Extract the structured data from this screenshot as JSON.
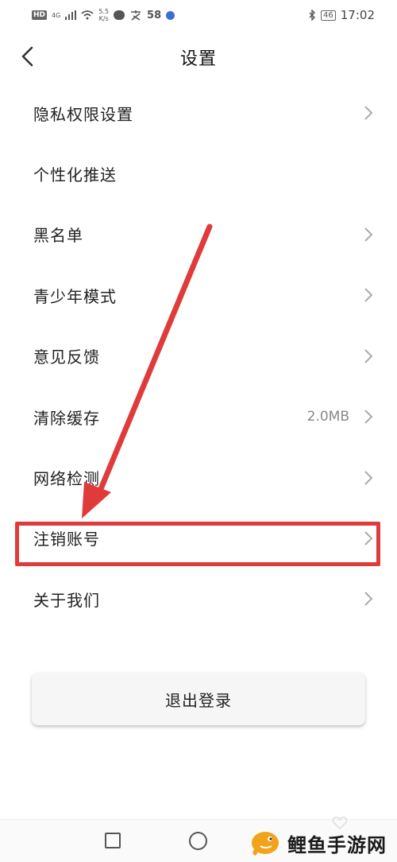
{
  "status_bar": {
    "hd": "HD",
    "network": "4G",
    "speed_value": "5.5",
    "speed_unit": "K/s",
    "notification_count": "58",
    "battery": "46",
    "time": "17:02"
  },
  "header": {
    "title": "设置"
  },
  "settings": {
    "items": [
      {
        "label": "隐私权限设置",
        "value": "",
        "chevron": true
      },
      {
        "label": "个性化推送",
        "value": "",
        "chevron": false
      },
      {
        "label": "黑名单",
        "value": "",
        "chevron": true
      },
      {
        "label": "青少年模式",
        "value": "",
        "chevron": true
      },
      {
        "label": "意见反馈",
        "value": "",
        "chevron": true
      },
      {
        "label": "清除缓存",
        "value": "2.0MB",
        "chevron": true
      },
      {
        "label": "网络检测",
        "value": "",
        "chevron": true
      },
      {
        "label": "注销账号",
        "value": "",
        "chevron": true
      },
      {
        "label": "关于我们",
        "value": "",
        "chevron": true
      }
    ]
  },
  "logout_label": "退出登录",
  "annotation": {
    "color": "#e03b3b",
    "target": "注销账号"
  },
  "watermark": {
    "text": "鲤鱼手游网"
  },
  "colors": {
    "accent_fish": "#f2a21b",
    "annotation_red": "#e03b3b"
  }
}
